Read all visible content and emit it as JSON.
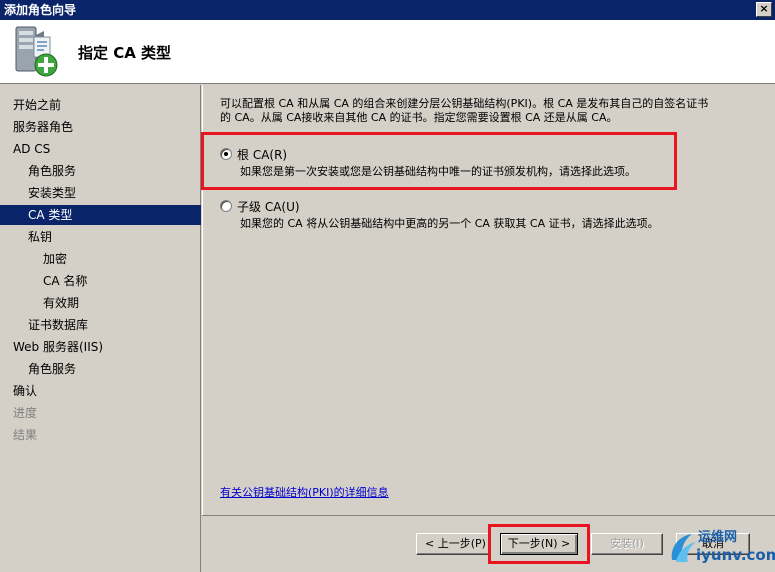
{
  "window": {
    "title": "添加角色向导",
    "close_glyph": "×"
  },
  "header": {
    "title": "指定 CA 类型",
    "icon": "server-add-icon"
  },
  "sidebar": {
    "items": [
      {
        "label": "开始之前",
        "state": "normal"
      },
      {
        "label": "服务器角色",
        "state": "normal"
      },
      {
        "label": "AD CS",
        "state": "normal"
      },
      {
        "label": "角色服务",
        "state": "normal"
      },
      {
        "label": "安装类型",
        "state": "normal"
      },
      {
        "label": "CA 类型",
        "state": "selected"
      },
      {
        "label": "私钥",
        "state": "normal"
      },
      {
        "label": "加密",
        "state": "normal"
      },
      {
        "label": "CA 名称",
        "state": "normal"
      },
      {
        "label": "有效期",
        "state": "normal"
      },
      {
        "label": "证书数据库",
        "state": "normal"
      },
      {
        "label": "Web 服务器(IIS)",
        "state": "normal"
      },
      {
        "label": "角色服务",
        "state": "normal"
      },
      {
        "label": "确认",
        "state": "normal"
      },
      {
        "label": "进度",
        "state": "disabled"
      },
      {
        "label": "结果",
        "state": "disabled"
      }
    ]
  },
  "main": {
    "description_line1": "可以配置根 CA 和从属 CA 的组合来创建分层公钥基础结构(PKI)。根 CA 是发布其自己的自签名证书",
    "description_line2": "的 CA。从属 CA接收来自其他 CA 的证书。指定您需要设置根 CA 还是从属 CA。",
    "options": [
      {
        "label": "根 CA(R)",
        "help": "如果您是第一次安装或您是公钥基础结构中唯一的证书颁发机构，请选择此选项。",
        "checked": true
      },
      {
        "label": "子级 CA(U)",
        "help": "如果您的 CA 将从公钥基础结构中更高的另一个 CA 获取其 CA 证书，请选择此选项。",
        "checked": false
      }
    ],
    "info_link": "有关公钥基础结构(PKI)的详细信息"
  },
  "footer": {
    "back_label": "< 上一步(P)",
    "next_label": "下一步(N) >",
    "install_label": "安装(I)",
    "cancel_label": "取消"
  },
  "watermark": {
    "line1": "运维网",
    "line2": "iyunv.com"
  },
  "colors": {
    "selection": "#0a246a",
    "highlight": "#e8141f",
    "link": "#0000cc"
  }
}
